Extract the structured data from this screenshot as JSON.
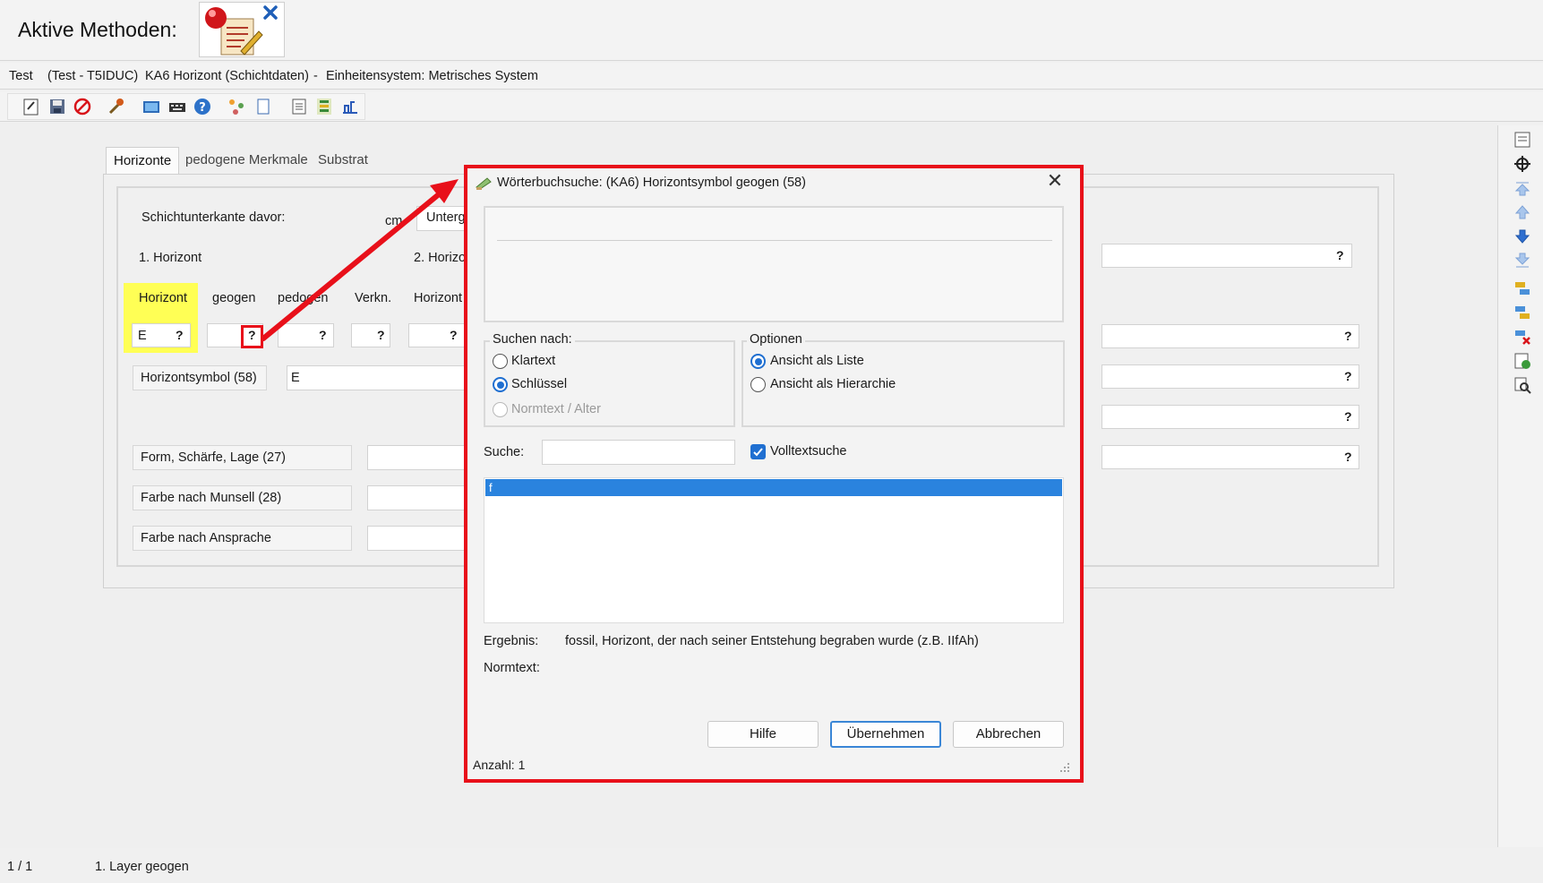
{
  "header": {
    "active_methods_label": "Aktive Methoden:"
  },
  "path_bar": {
    "project": "Test",
    "db": "(Test - T5IDUC)",
    "dataset": "KA6 Horizont (Schichtdaten)",
    "sep": "-",
    "units": "Einheitensystem: Metrisches System"
  },
  "tabs": [
    "Horizonte",
    "pedogene Merkmale",
    "Substrat"
  ],
  "form": {
    "layer_bottom_label": "Schichtunterkante davor:",
    "unit_cm": "cm",
    "unterg_label": "Unterg",
    "horizon1_label": "1. Horizont",
    "horizon2_label": "2. Horizo",
    "col_horizont": "Horizont",
    "col_geogen": "geogen",
    "col_pedogen": "pedogen",
    "col_verkn": "Verkn.",
    "col_horizont2": "Horizont",
    "horizont_value": "E",
    "q": "?",
    "horizontsymbol_label": "Horizontsymbol (58)",
    "horizontsymbol_value": "E",
    "form_label": "Form, Schärfe, Lage (27)",
    "farbe_munsell_label": "Farbe nach Munsell (28)",
    "farbe_ansprache_label": "Farbe nach Ansprache"
  },
  "dialog": {
    "title": "Wörterbuchsuche: (KA6) Horizontsymbol geogen (58)",
    "close": "✕",
    "search_by": {
      "legend": "Suchen nach:",
      "options": [
        "Klartext",
        "Schlüssel",
        "Normtext / Alter"
      ],
      "selected": "Schlüssel"
    },
    "options_group": {
      "legend": "Optionen",
      "options": [
        "Ansicht als Liste",
        "Ansicht als Hierarchie"
      ],
      "selected": "Ansicht als Liste"
    },
    "search_label": "Suche:",
    "search_value": "",
    "fulltext_label": "Volltextsuche",
    "fulltext_checked": true,
    "results": [
      "f"
    ],
    "ergebnis_label": "Ergebnis:",
    "ergebnis_value": "fossil, Horizont, der nach seiner Entstehung begraben wurde (z.B. IIfAh)",
    "normtext_label": "Normtext:",
    "buttons": {
      "help": "Hilfe",
      "apply": "Übernehmen",
      "cancel": "Abbrechen"
    },
    "count": "Anzahl: 1"
  },
  "status_bar": {
    "page": "1 / 1",
    "info": "1. Layer geogen"
  },
  "colors": {
    "highlight_yellow": "#ffff55",
    "annotation_red": "#e8101a",
    "selection_blue": "#2a83de"
  }
}
